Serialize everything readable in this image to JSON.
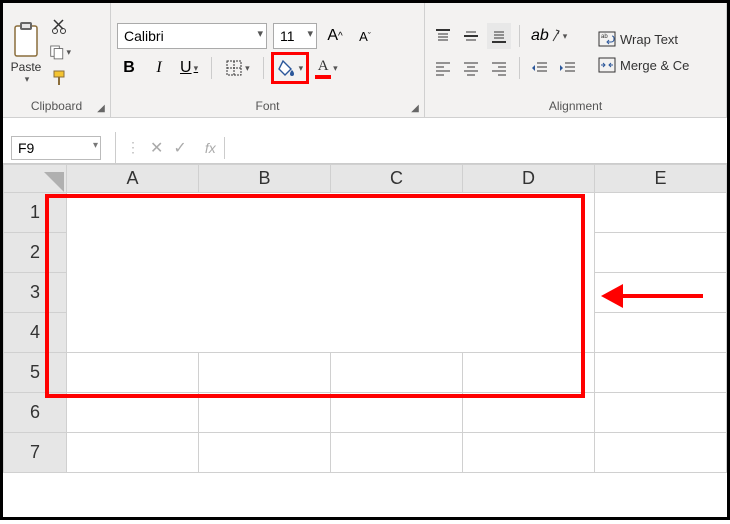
{
  "ribbon": {
    "clipboard": {
      "label": "Clipboard",
      "paste": "Paste"
    },
    "font": {
      "label": "Font",
      "fontname": "Calibri",
      "fontsize": "11",
      "bold": "B",
      "italic": "I",
      "underline": "U"
    },
    "alignment": {
      "label": "Alignment",
      "wrap": "Wrap Text",
      "merge": "Merge & Ce"
    }
  },
  "namebox": "F9",
  "fx_label": "fx",
  "columns": [
    "A",
    "B",
    "C",
    "D",
    "E"
  ],
  "rows": [
    "1",
    "2",
    "3",
    "4",
    "5",
    "6",
    "7"
  ]
}
